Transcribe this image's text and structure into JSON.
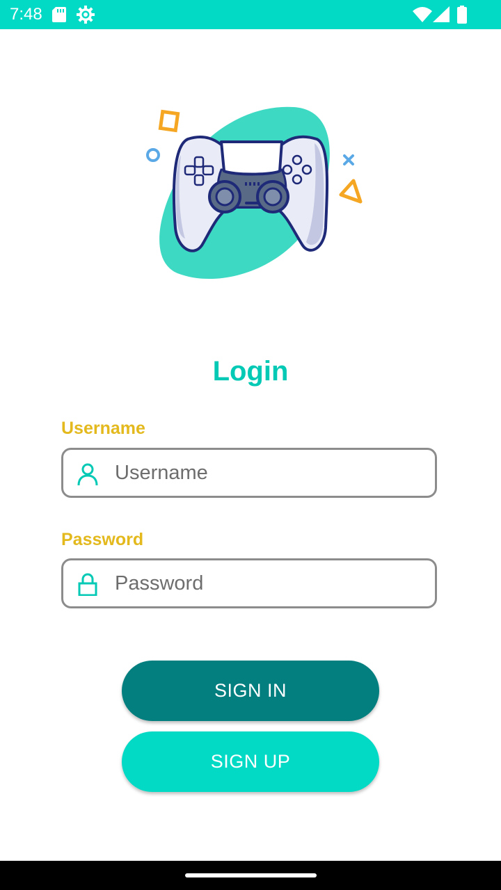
{
  "status_bar": {
    "time": "7:48",
    "background": "#03dac5",
    "left_icons": [
      "sd-card-icon",
      "settings-gear-icon"
    ],
    "right_icons": [
      "wifi-icon",
      "signal-icon",
      "battery-icon"
    ]
  },
  "illustration": {
    "name": "game-controller-illustration",
    "blob_color": "#3ed9c3",
    "controller_color": "#e9ebf7",
    "outline_color": "#1e2a78"
  },
  "login": {
    "title": "Login",
    "title_color": "#03c9b5",
    "label_color": "#e3b91e",
    "username": {
      "label": "Username",
      "placeholder": "Username",
      "value": "",
      "icon": "person-icon"
    },
    "password": {
      "label": "Password",
      "placeholder": "Password",
      "value": "",
      "icon": "lock-icon"
    }
  },
  "buttons": {
    "sign_in": {
      "label": "SIGN IN",
      "color": "#037f80"
    },
    "sign_up": {
      "label": "SIGN UP",
      "color": "#03dac5"
    }
  }
}
